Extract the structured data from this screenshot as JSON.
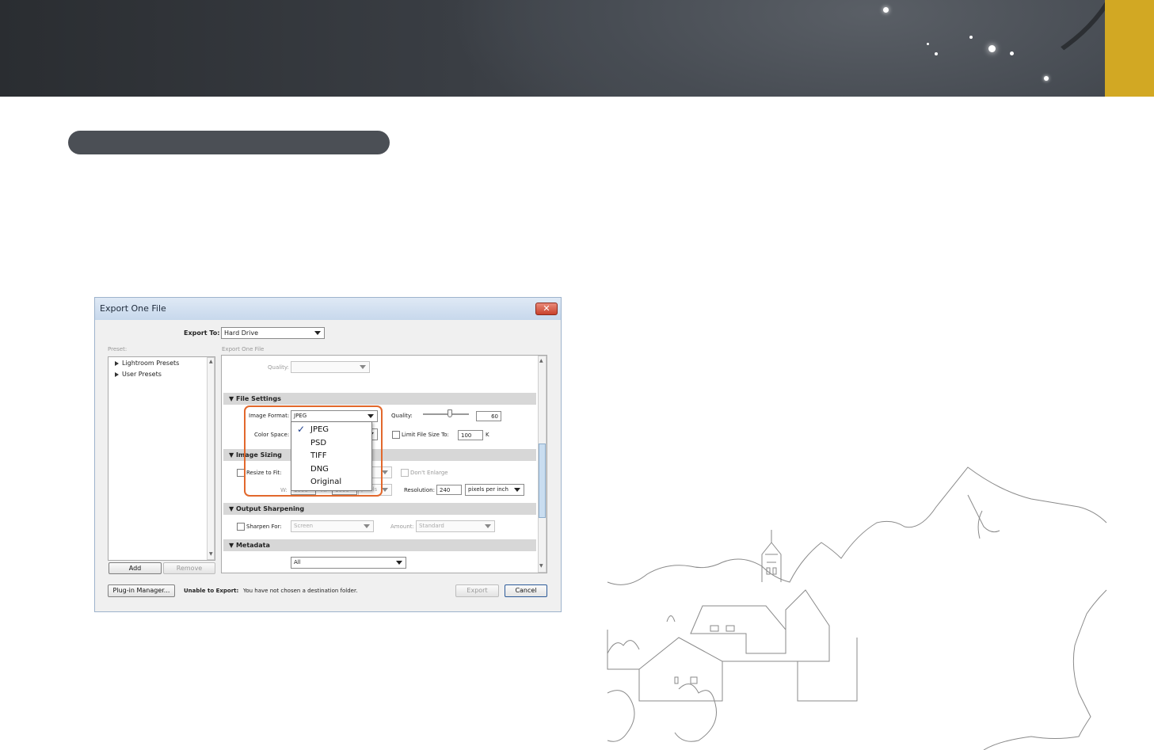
{
  "dialog": {
    "title": "Export One File",
    "close_glyph": "✕",
    "export_to_label": "Export To:",
    "export_to_value": "Hard Drive",
    "preset_label": "Preset:",
    "preset_items": [
      "Lightroom Presets",
      "User Presets"
    ],
    "add_label": "Add",
    "remove_label": "Remove",
    "panel_title": "Export One File",
    "quality_top_label": "Quality:",
    "sections": {
      "file_settings": "File Settings",
      "image_sizing": "Image Sizing",
      "output_sharpening": "Output Sharpening",
      "metadata": "Metadata"
    },
    "image_format_label": "Image Format:",
    "image_format_value": "JPEG",
    "quality_label": "Quality:",
    "quality_value": "60",
    "color_space_label": "Color Space:",
    "limit_file_size_label": "Limit File Size To:",
    "limit_file_size_value": "100",
    "limit_file_size_unit": "K",
    "resize_to_fit_label": "Resize to Fit:",
    "dont_enlarge_label": "Don't Enlarge",
    "w_label": "W:",
    "w_value": "1000",
    "h_label": "H:",
    "h_value": "1000",
    "pixels_value": "pixels",
    "resolution_label": "Resolution:",
    "resolution_value": "240",
    "resolution_unit": "pixels per inch",
    "sharpen_for_label": "Sharpen For:",
    "sharpen_for_value": "Screen",
    "amount_label": "Amount:",
    "amount_value": "Standard",
    "metadata_value": "All",
    "plugin_manager_label": "Plug-in Manager...",
    "status_bold": "Unable to Export:",
    "status_text": "You have not chosen a destination folder.",
    "export_label": "Export",
    "cancel_label": "Cancel",
    "format_options": [
      "JPEG",
      "PSD",
      "TIFF",
      "DNG",
      "Original"
    ],
    "selected_format": "JPEG",
    "check_glyph": "✓"
  },
  "colors": {
    "accent_gold": "#d2a823",
    "highlight_orange": "#e2682c",
    "banner_dark": "#3a3e44"
  }
}
